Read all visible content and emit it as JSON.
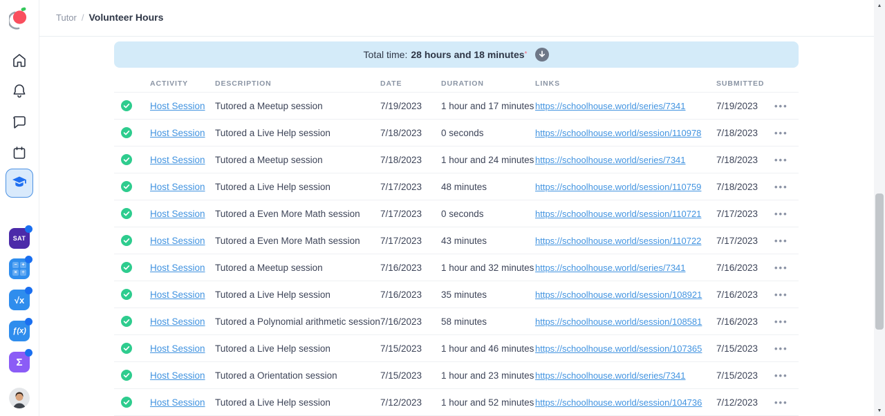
{
  "breadcrumb": {
    "section": "Tutor",
    "separator": "/",
    "current": "Volunteer Hours"
  },
  "banner": {
    "label": "Total time:",
    "value": "28 hours and 18 minutes",
    "asterisk": "*",
    "download_icon": "download-circle-icon"
  },
  "sidebar": {
    "logo": "schoolhouse-world-logo",
    "nav_icons": [
      "home-icon",
      "bell-icon",
      "chat-icon",
      "calendar-icon",
      "graduation-cap-icon"
    ],
    "active_item": "tutoring",
    "subjects": {
      "sat_label": "SAT",
      "grid_ops": {
        "a": "−",
        "b": "+",
        "c": "×",
        "d": "÷"
      },
      "sqrt_label": "√x",
      "fx_label": "ƒ(x)",
      "sigma_label": "Σ"
    },
    "avatar": "user-avatar"
  },
  "table": {
    "headers": [
      "ACTIVITY",
      "DESCRIPTION",
      "DATE",
      "DURATION",
      "LINKS",
      "SUBMITTED"
    ],
    "more_label": "•••",
    "rows": [
      {
        "activity": "Host Session",
        "description": "Tutored a Meetup session",
        "date": "7/19/2023",
        "duration": "1 hour and 17 minutes",
        "link": "https://schoolhouse.world/series/7341",
        "submitted": "7/19/2023"
      },
      {
        "activity": "Host Session",
        "description": "Tutored a Live Help session",
        "date": "7/18/2023",
        "duration": "0 seconds",
        "link": "https://schoolhouse.world/session/110978",
        "submitted": "7/18/2023"
      },
      {
        "activity": "Host Session",
        "description": "Tutored a Meetup session",
        "date": "7/18/2023",
        "duration": "1 hour and 24 minutes",
        "link": "https://schoolhouse.world/series/7341",
        "submitted": "7/18/2023"
      },
      {
        "activity": "Host Session",
        "description": "Tutored a Live Help session",
        "date": "7/17/2023",
        "duration": "48 minutes",
        "link": "https://schoolhouse.world/session/110759",
        "submitted": "7/18/2023"
      },
      {
        "activity": "Host Session",
        "description": "Tutored a Even More Math session",
        "date": "7/17/2023",
        "duration": "0 seconds",
        "link": "https://schoolhouse.world/session/110721",
        "submitted": "7/17/2023"
      },
      {
        "activity": "Host Session",
        "description": "Tutored a Even More Math session",
        "date": "7/17/2023",
        "duration": "43 minutes",
        "link": "https://schoolhouse.world/session/110722",
        "submitted": "7/17/2023"
      },
      {
        "activity": "Host Session",
        "description": "Tutored a Meetup session",
        "date": "7/16/2023",
        "duration": "1 hour and 32 minutes",
        "link": "https://schoolhouse.world/series/7341",
        "submitted": "7/16/2023"
      },
      {
        "activity": "Host Session",
        "description": "Tutored a Live Help session",
        "date": "7/16/2023",
        "duration": "35 minutes",
        "link": "https://schoolhouse.world/session/108921",
        "submitted": "7/16/2023"
      },
      {
        "activity": "Host Session",
        "description": "Tutored a Polynomial arithmetic session",
        "date": "7/16/2023",
        "duration": "58 minutes",
        "link": "https://schoolhouse.world/session/108581",
        "submitted": "7/16/2023"
      },
      {
        "activity": "Host Session",
        "description": "Tutored a Live Help session",
        "date": "7/15/2023",
        "duration": "1 hour and 46 minutes",
        "link": "https://schoolhouse.world/session/107365",
        "submitted": "7/15/2023"
      },
      {
        "activity": "Host Session",
        "description": "Tutored a Orientation session",
        "date": "7/15/2023",
        "duration": "1 hour and 23 minutes",
        "link": "https://schoolhouse.world/series/7341",
        "submitted": "7/15/2023"
      },
      {
        "activity": "Host Session",
        "description": "Tutored a Live Help session",
        "date": "7/12/2023",
        "duration": "1 hour and 52 minutes",
        "link": "https://schoolhouse.world/session/104736",
        "submitted": "7/12/2023"
      }
    ]
  },
  "colors": {
    "accent_link": "#4193e0",
    "status_green": "#2ecc8e",
    "banner_bg": "#d4ebf9",
    "active_nav_bg": "#d9eafc",
    "active_nav_border": "#4a90e2",
    "logo_red": "#f94f5e",
    "logo_green": "#33c759",
    "sat_purple": "#4b2aa9",
    "subject_blue": "#2f8ded",
    "sigma_purple": "#8b5cf6",
    "notification_dot": "#1a6ff0"
  }
}
